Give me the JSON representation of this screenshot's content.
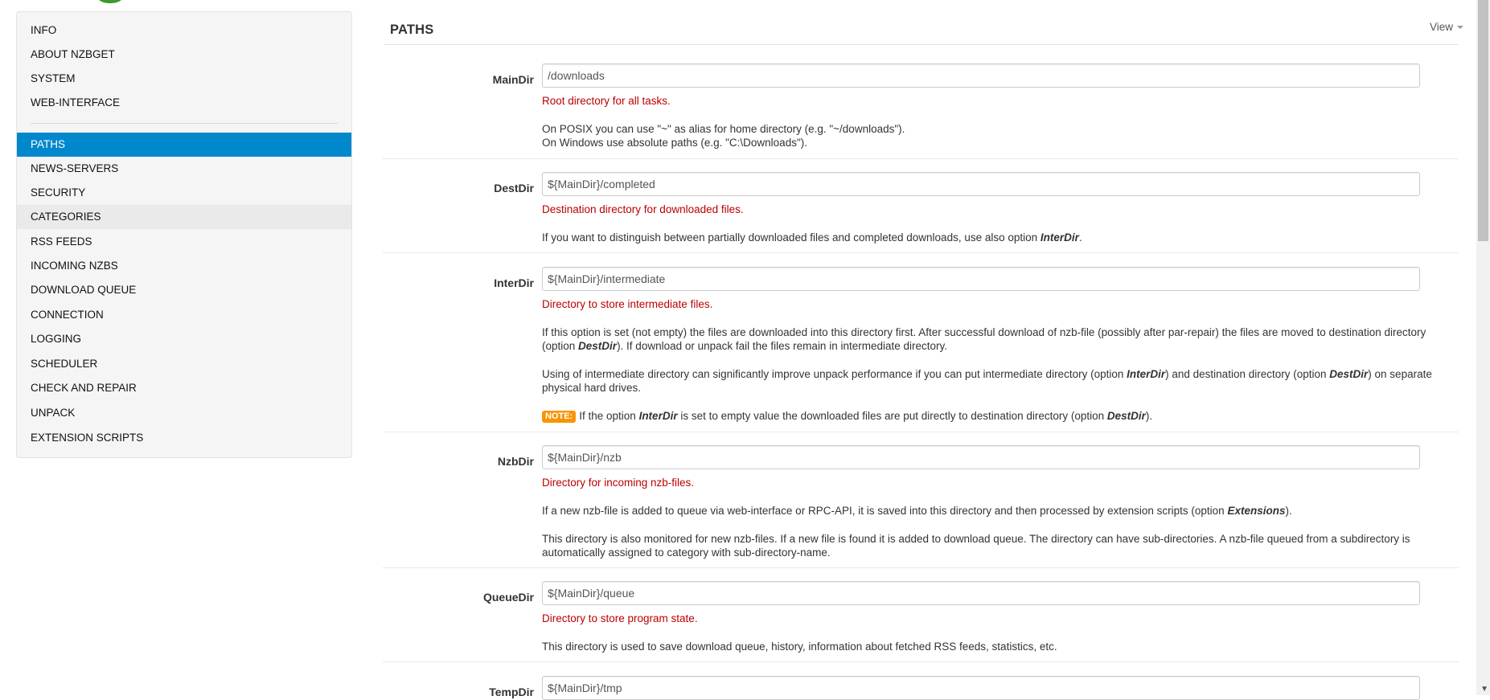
{
  "sidebar": {
    "items": [
      {
        "label": "INFO"
      },
      {
        "label": "ABOUT NZBGET"
      },
      {
        "label": "SYSTEM"
      },
      {
        "label": "WEB-INTERFACE"
      },
      {
        "label": "PATHS"
      },
      {
        "label": "NEWS-SERVERS"
      },
      {
        "label": "SECURITY"
      },
      {
        "label": "CATEGORIES"
      },
      {
        "label": "RSS FEEDS"
      },
      {
        "label": "INCOMING NZBS"
      },
      {
        "label": "DOWNLOAD QUEUE"
      },
      {
        "label": "CONNECTION"
      },
      {
        "label": "LOGGING"
      },
      {
        "label": "SCHEDULER"
      },
      {
        "label": "CHECK AND REPAIR"
      },
      {
        "label": "UNPACK"
      },
      {
        "label": "EXTENSION SCRIPTS"
      }
    ],
    "active": "PATHS",
    "hovered": "CATEGORIES"
  },
  "main": {
    "title": "PATHS",
    "view_menu": "View"
  },
  "options": {
    "maindir": {
      "name": "MainDir",
      "value": "/downloads",
      "short": "Root directory for all tasks.",
      "desc1": "On POSIX you can use \"~\" as alias for home directory (e.g. \"~/downloads\").",
      "desc2": "On Windows use absolute paths (e.g. \"C:\\Downloads\")."
    },
    "destdir": {
      "name": "DestDir",
      "value": "${MainDir}/completed",
      "short": "Destination directory for downloaded files.",
      "desc1": "If you want to distinguish between partially downloaded files and completed downloads, use also option",
      "desc1_ref": "InterDir",
      "desc1_end": "."
    },
    "interdir": {
      "name": "InterDir",
      "value": "${MainDir}/intermediate",
      "short": "Directory to store intermediate files.",
      "p1a": "If this option is set (not empty) the files are downloaded into this directory first. After successful download of nzb-file (possibly after par-repair) the files are moved to destination directory (option",
      "p1_ref": "DestDir",
      "p1b": "). If download or unpack fail the files remain in intermediate directory.",
      "p2a": "Using of intermediate directory can significantly improve unpack performance if you can put intermediate directory (option",
      "p2_ref1": "InterDir",
      "p2b": ") and destination directory (option",
      "p2_ref2": "DestDir",
      "p2c": ") on separate physical hard drives.",
      "note_badge": "NOTE:",
      "note_a": "If the option",
      "note_ref1": "InterDir",
      "note_b": "is set to empty value the downloaded files are put directly to destination directory (option",
      "note_ref2": "DestDir",
      "note_c": ")."
    },
    "nzbdir": {
      "name": "NzbDir",
      "value": "${MainDir}/nzb",
      "short": "Directory for incoming nzb-files.",
      "p1a": "If a new nzb-file is added to queue via web-interface or RPC-API, it is saved into this directory and then processed by extension scripts (option",
      "p1_ref": "Extensions",
      "p1b": ").",
      "p2": "This directory is also monitored for new nzb-files. If a new file is found it is added to download queue. The directory can have sub-directories. A nzb-file queued from a subdirectory is automatically assigned to category with sub-directory-name."
    },
    "queuedir": {
      "name": "QueueDir",
      "value": "${MainDir}/queue",
      "short": "Directory to store program state.",
      "p1": "This directory is used to save download queue, history, information about fetched RSS feeds, statistics, etc."
    },
    "tempdir": {
      "name": "TempDir",
      "value": "${MainDir}/tmp"
    }
  },
  "colors": {
    "active_nav": "#0088cc",
    "short_desc": "#bb0000",
    "note_badge": "#f89406"
  }
}
